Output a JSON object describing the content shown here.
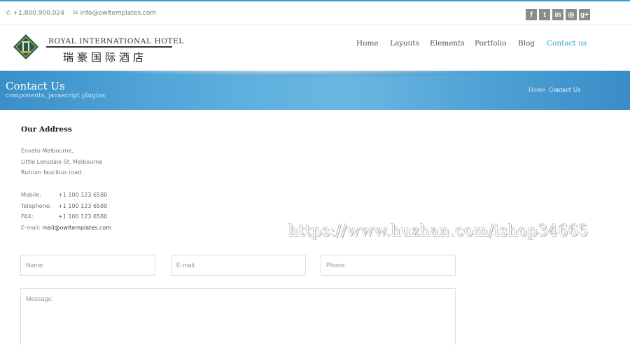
{
  "topbar": {
    "phone_icon": "phone-icon",
    "phone": "+1.800.900.024",
    "email_icon": "envelope-icon",
    "email": "info@owltemplates.com",
    "socials": [
      {
        "icon": "facebook-icon",
        "glyph": "f"
      },
      {
        "icon": "twitter-icon",
        "glyph": "t"
      },
      {
        "icon": "linkedin-icon",
        "glyph": "in"
      },
      {
        "icon": "dribbble-icon",
        "glyph": "◎"
      },
      {
        "icon": "google-plus-icon",
        "glyph": "g+"
      }
    ]
  },
  "logo": {
    "name_en": "ROYAL INTERNATIONAL HOTEL",
    "name_cn": "瑞豪国际酒店"
  },
  "nav": {
    "items": [
      "Home",
      "Layouts",
      "Elements",
      "Portfolio",
      "Blog",
      "Contact us"
    ],
    "active": "Contact us"
  },
  "banner": {
    "title": "Contact Us",
    "subtitle": "components, javascript plugins",
    "breadcrumb_home": "Home",
    "breadcrumb_current": "Contact Us"
  },
  "address": {
    "title": "Our Address",
    "lines": [
      "Envato Melbourne,",
      "Little Lonsdale St, Melbourne",
      "Rutrum faucibus road."
    ],
    "mobile_label": "Mobile:",
    "mobile": "+1 100 123 6580",
    "telephone_label": "Telephone:",
    "telephone": "+1 100 123 6580",
    "fax_label": "FAX:",
    "fax": "+1 100 123 6580",
    "email_label": "E-mail:",
    "email": "mail@owltemplates.com"
  },
  "watermark": "https://www.huzhan.com/ishop34665",
  "form": {
    "name_placeholder": "Name:",
    "email_placeholder": "E-mail:",
    "phone_placeholder": "Phone:",
    "message_placeholder": "Message:"
  },
  "colors": {
    "accent": "#2fa3d4",
    "banner": "#5aaedd",
    "social_bg": "#8c8c8c"
  }
}
